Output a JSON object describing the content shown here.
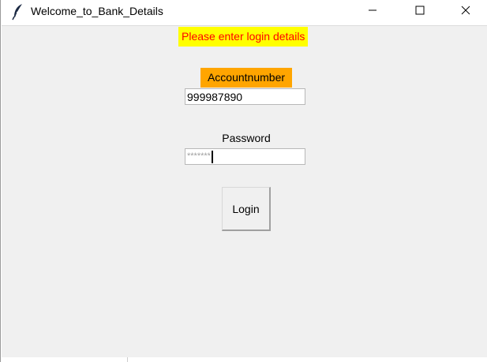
{
  "window": {
    "title": "Welcome_to_Bank_Details",
    "app_icon": "feather-icon",
    "controls": {
      "minimize_icon": "minimize-icon",
      "maximize_icon": "maximize-icon",
      "close_icon": "close-icon"
    }
  },
  "form": {
    "message": "Please enter login details",
    "account_label": "Accountnumber",
    "account_value": "999987890",
    "password_label": "Password",
    "password_masked": "*******",
    "login_label": "Login"
  },
  "colors": {
    "message_bg": "#ffff00",
    "message_fg": "#ff0000",
    "account_label_bg": "#ffa500",
    "client_bg": "#f0f0f0"
  }
}
